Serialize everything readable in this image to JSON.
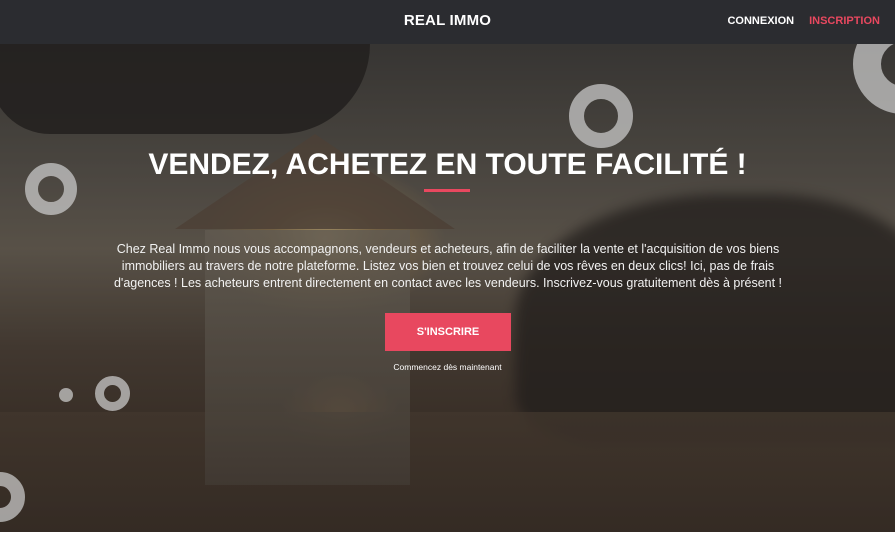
{
  "header": {
    "brand": "REAL IMMO",
    "nav": {
      "login_label": "CONNEXION",
      "signup_label": "INSCRIPTION"
    }
  },
  "hero": {
    "headline": "VENDEZ, ACHETEZ EN TOUTE FACILITÉ !",
    "intro": "Chez Real Immo nous vous accompagnons, vendeurs et acheteurs, afin de faciliter la vente et l'acquisition de vos biens immobiliers au travers de notre plateforme. Listez vos bien et trouvez celui de vos rêves en deux clics! Ici, pas de frais d'agences ! Les acheteurs entrent directement en contact avec les vendeurs. Inscrivez-vous gratuitement dès à présent !",
    "cta_label": "S'INSCRIRE",
    "cta_subtext": "Commencez dès maintenant",
    "background_image": "house-model-sunset-photo"
  },
  "colors": {
    "navbar_bg": "#2b2c30",
    "accent": "#e8485f",
    "text_light": "#ffffff"
  }
}
